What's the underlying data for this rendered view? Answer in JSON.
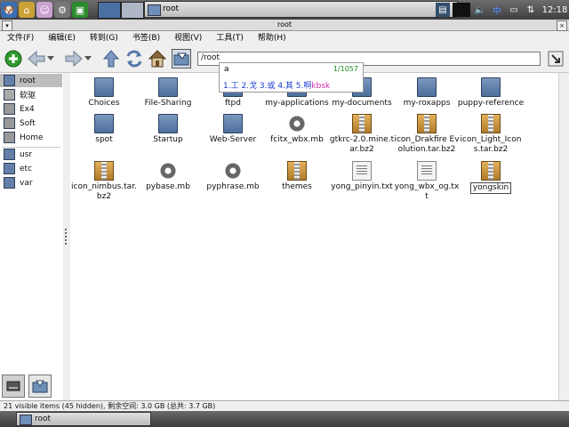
{
  "taskbar_top": {
    "launchers": [
      "puppy-icon",
      "home-icon",
      "tool-icon",
      "settings-icon",
      "monitor-icon"
    ],
    "task": {
      "label": "root"
    },
    "clock": "12:18",
    "ime_indicator": "中"
  },
  "window": {
    "title": "root"
  },
  "menu": [
    {
      "label": "文件(F)"
    },
    {
      "label": "编辑(E)"
    },
    {
      "label": "转到(G)"
    },
    {
      "label": "书签(B)"
    },
    {
      "label": "视图(V)"
    },
    {
      "label": "工具(T)"
    },
    {
      "label": "帮助(H)"
    }
  ],
  "location": {
    "path": "/root"
  },
  "ime": {
    "input": "a",
    "page": "1/1057",
    "candidates": "1.工 2.戈 3.或 4.其 5.啊",
    "code": "kbsk"
  },
  "sidebar": {
    "places": [
      "root",
      "软驱",
      "Ex4",
      "Soft",
      "Home"
    ],
    "bookmarks": [
      "usr",
      "etc",
      "var"
    ]
  },
  "files": [
    {
      "name": "Choices",
      "icon": "folder"
    },
    {
      "name": "File-Sharing",
      "icon": "folder"
    },
    {
      "name": "ftpd",
      "icon": "folder"
    },
    {
      "name": "my-applications",
      "icon": "folder"
    },
    {
      "name": "my-documents",
      "icon": "folder"
    },
    {
      "name": "my-roxapps",
      "icon": "folder"
    },
    {
      "name": "puppy-reference",
      "icon": "folder"
    },
    {
      "name": "spot",
      "icon": "folder"
    },
    {
      "name": "Startup",
      "icon": "folder"
    },
    {
      "name": "Web-Server",
      "icon": "folder"
    },
    {
      "name": "fcitx_wbx.mb",
      "icon": "gear"
    },
    {
      "name": "gtkrc-2.0.mine.tar.bz2",
      "icon": "archive"
    },
    {
      "name": "icon_Drakfire Evolution.tar.bz2",
      "icon": "archive"
    },
    {
      "name": "icon_Light_Icons.tar.bz2",
      "icon": "archive"
    },
    {
      "name": "icon_nimbus.tar.bz2",
      "icon": "archive"
    },
    {
      "name": "pybase.mb",
      "icon": "gear"
    },
    {
      "name": "pyphrase.mb",
      "icon": "gear"
    },
    {
      "name": "themes",
      "icon": "archive"
    },
    {
      "name": "yong_pinyin.txt",
      "icon": "text"
    },
    {
      "name": "yong_wbx_og.txt",
      "icon": "text"
    },
    {
      "name": "yongskin",
      "icon": "archive"
    }
  ],
  "status": {
    "text": "21 visible items (45 hidden), 剩余空间: 3.0 GB (总共: 3.7 GB)"
  },
  "taskbar_bottom": {
    "task": {
      "label": "root"
    }
  },
  "colors": {
    "ime_candidate": "#1c3fd0",
    "ime_code": "#d42bb0",
    "ime_page": "#1a8a1a"
  }
}
